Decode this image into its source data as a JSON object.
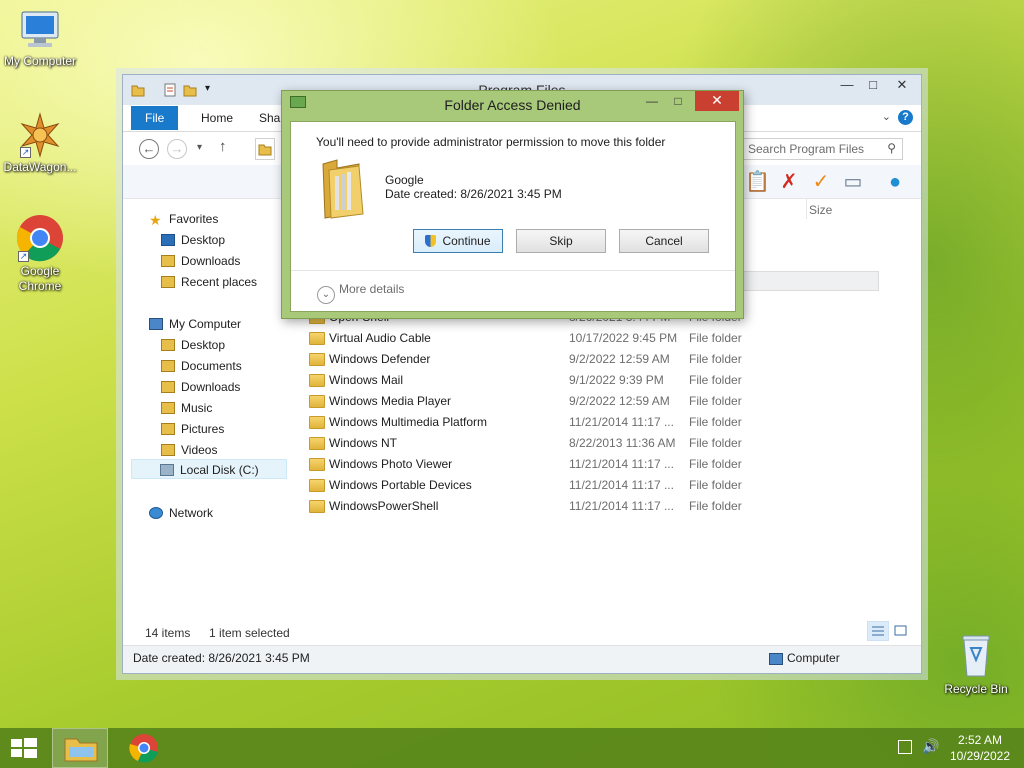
{
  "desktop": {
    "icons": [
      {
        "label": "My Computer",
        "icon": "computer-icon"
      },
      {
        "label": "DataWagon...",
        "icon": "datawagon-icon"
      },
      {
        "label": "Google Chrome",
        "icon": "chrome-icon"
      },
      {
        "label": "Recycle Bin",
        "icon": "recycle-bin-icon"
      }
    ]
  },
  "explorer": {
    "title": "Program Files",
    "tabs": {
      "file": "File",
      "home": "Home",
      "share": "Shar"
    },
    "search_placeholder": "Search Program Files",
    "column_size": "Size",
    "sidebar": {
      "favorites": "Favorites",
      "fav_desktop": "Desktop",
      "fav_downloads": "Downloads",
      "fav_recent": "Recent places",
      "computer": "My Computer",
      "desktop": "Desktop",
      "documents": "Documents",
      "downloads": "Downloads",
      "music": "Music",
      "pictures": "Pictures",
      "videos": "Videos",
      "local_disk": "Local Disk (C:)",
      "network": "Network"
    },
    "files": [
      {
        "name": "Open-Shell",
        "date": "8/26/2021 3:44 PM",
        "type": "File folder"
      },
      {
        "name": "Virtual Audio Cable",
        "date": "10/17/2022 9:45 PM",
        "type": "File folder"
      },
      {
        "name": "Windows Defender",
        "date": "9/2/2022 12:59 AM",
        "type": "File folder"
      },
      {
        "name": "Windows Mail",
        "date": "9/1/2022 9:39 PM",
        "type": "File folder"
      },
      {
        "name": "Windows Media Player",
        "date": "9/2/2022 12:59 AM",
        "type": "File folder"
      },
      {
        "name": "Windows Multimedia Platform",
        "date": "11/21/2014 11:17 ...",
        "type": "File folder"
      },
      {
        "name": "Windows NT",
        "date": "8/22/2013 11:36 AM",
        "type": "File folder"
      },
      {
        "name": "Windows Photo Viewer",
        "date": "11/21/2014 11:17 ...",
        "type": "File folder"
      },
      {
        "name": "Windows Portable Devices",
        "date": "11/21/2014 11:17 ...",
        "type": "File folder"
      },
      {
        "name": "WindowsPowerShell",
        "date": "11/21/2014 11:17 ...",
        "type": "File folder"
      }
    ],
    "status": {
      "count": "14 items",
      "selected": "1 item selected"
    },
    "details": {
      "date_created": "Date created: 8/26/2021 3:45 PM",
      "location": "Computer"
    }
  },
  "dialog": {
    "title": "Folder Access Denied",
    "message": "You'll need to provide administrator permission to move this folder",
    "folder_name": "Google",
    "folder_date": "Date created: 8/26/2021 3:45 PM",
    "continue": "Continue",
    "skip": "Skip",
    "cancel": "Cancel",
    "more_details": "More details"
  },
  "taskbar": {
    "time": "2:52 AM",
    "date": "10/29/2022"
  },
  "colors": {
    "accent": "#1979ca",
    "dialog_frame": "#a8c97a",
    "close_red": "#c94030",
    "taskbar": "#58861a"
  }
}
